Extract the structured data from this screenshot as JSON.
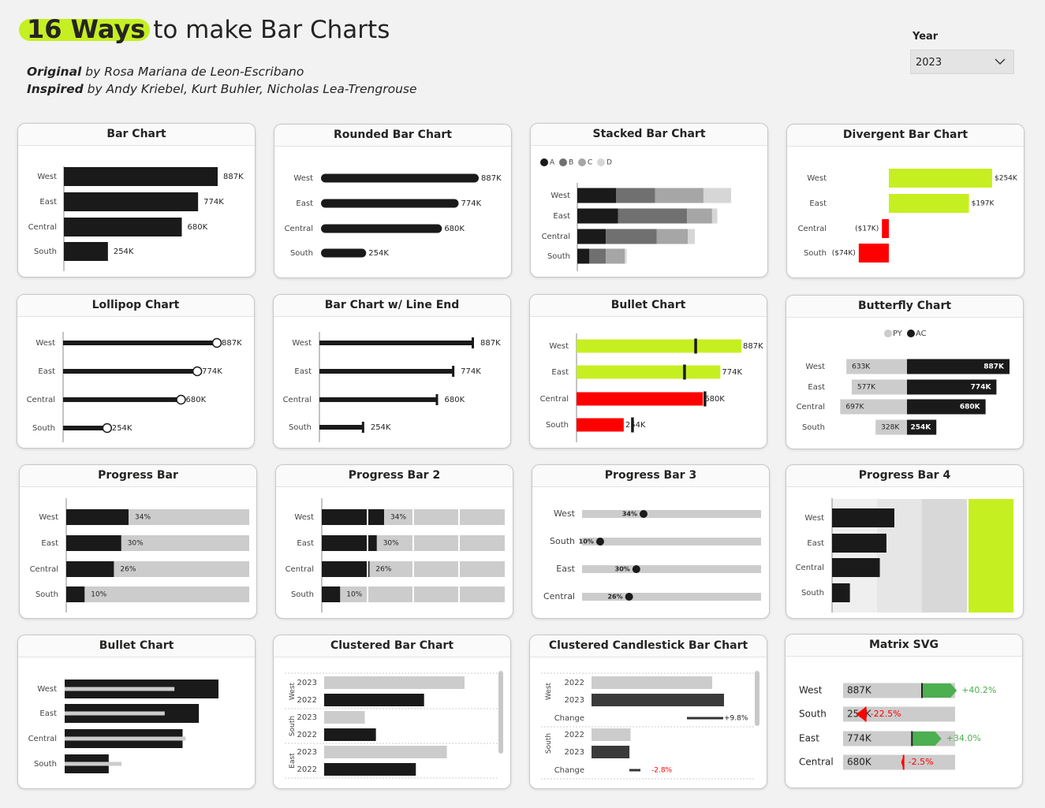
{
  "header": {
    "title_highlight": "16 Ways",
    "title_rest": " to make Bar Charts",
    "original_label": "Original",
    "original_by": " by Rosa Mariana de Leon-Escribano",
    "inspired_label": "Inspired",
    "inspired_by": " by Andy Kriebel, Kurt Buhler, Nicholas Lea-Trengrouse"
  },
  "filter": {
    "label": "Year",
    "value": "2023"
  },
  "colors": {
    "black": "#1a1a1a",
    "lime": "#c6ef21",
    "red": "#ff0000",
    "grey": "#cccccc",
    "darkgrey": "#707070",
    "midgrey": "#a6a6a6",
    "green": "#4caf50"
  },
  "cards": {
    "bar": {
      "title": "Bar Chart"
    },
    "rounded": {
      "title": "Rounded Bar Chart"
    },
    "stacked": {
      "title": "Stacked Bar Chart"
    },
    "divergent": {
      "title": "Divergent Bar Chart"
    },
    "lollipop": {
      "title": "Lollipop Chart"
    },
    "lineend": {
      "title": "Bar Chart w/ Line End"
    },
    "bullet1": {
      "title": "Bullet Chart"
    },
    "butterfly": {
      "title": "Butterfly Chart"
    },
    "progress1": {
      "title": "Progress Bar"
    },
    "progress2": {
      "title": "Progress Bar 2"
    },
    "progress3": {
      "title": "Progress Bar 3"
    },
    "progress4": {
      "title": "Progress Bar 4"
    },
    "bullet2": {
      "title": "Bullet Chart"
    },
    "clustered": {
      "title": "Clustered Bar Chart"
    },
    "candlestick": {
      "title": "Clustered Candlestick Bar Chart"
    },
    "matrix": {
      "title": "Matrix SVG"
    }
  },
  "chart_data": [
    {
      "id": "bar",
      "type": "bar",
      "title": "Bar Chart",
      "categories": [
        "West",
        "East",
        "Central",
        "South"
      ],
      "values": [
        887,
        774,
        680,
        254
      ],
      "labels": [
        "887K",
        "774K",
        "680K",
        "254K"
      ]
    },
    {
      "id": "rounded",
      "type": "bar",
      "title": "Rounded Bar Chart",
      "categories": [
        "West",
        "East",
        "Central",
        "South"
      ],
      "values": [
        887,
        774,
        680,
        254
      ],
      "labels": [
        "887K",
        "774K",
        "680K",
        "254K"
      ]
    },
    {
      "id": "stacked",
      "type": "bar",
      "title": "Stacked Bar Chart",
      "categories": [
        "West",
        "East",
        "Central",
        "South"
      ],
      "legend": [
        "A",
        "B",
        "C",
        "D"
      ],
      "series": [
        {
          "name": "A",
          "values": [
            225,
            235,
            165,
            70
          ]
        },
        {
          "name": "B",
          "values": [
            225,
            400,
            295,
            95
          ]
        },
        {
          "name": "C",
          "values": [
            280,
            145,
            180,
            110
          ]
        },
        {
          "name": "D",
          "values": [
            160,
            30,
            40,
            10
          ]
        }
      ]
    },
    {
      "id": "divergent",
      "type": "bar",
      "title": "Divergent Bar Chart",
      "categories": [
        "West",
        "East",
        "Central",
        "South"
      ],
      "values": [
        254,
        197,
        -17,
        -74
      ],
      "labels": [
        "$254K",
        "$197K",
        "($17K)",
        "($74K)"
      ]
    },
    {
      "id": "lollipop",
      "type": "bar",
      "title": "Lollipop Chart",
      "categories": [
        "West",
        "East",
        "Central",
        "South"
      ],
      "values": [
        887,
        774,
        680,
        254
      ],
      "labels": [
        "887K",
        "774K",
        "680K",
        "254K"
      ]
    },
    {
      "id": "lineend",
      "type": "bar",
      "title": "Bar Chart w/ Line End",
      "categories": [
        "West",
        "East",
        "Central",
        "South"
      ],
      "values": [
        887,
        774,
        680,
        254
      ],
      "labels": [
        "887K",
        "774K",
        "680K",
        "254K"
      ]
    },
    {
      "id": "bullet1",
      "type": "bar",
      "title": "Bullet Chart",
      "categories": [
        "West",
        "East",
        "Central",
        "South"
      ],
      "values": [
        887,
        774,
        680,
        254
      ],
      "targets": [
        640,
        580,
        690,
        300
      ],
      "status": [
        "lime",
        "lime",
        "red",
        "red"
      ],
      "labels": [
        "887K",
        "774K",
        "680K",
        "254K"
      ]
    },
    {
      "id": "butterfly",
      "type": "bar",
      "title": "Butterfly Chart",
      "categories": [
        "West",
        "East",
        "Central",
        "South"
      ],
      "legend": [
        "PY",
        "AC"
      ],
      "series": [
        {
          "name": "PY",
          "values": [
            633,
            577,
            697,
            328
          ],
          "labels": [
            "633K",
            "577K",
            "697K",
            "328K"
          ]
        },
        {
          "name": "AC",
          "values": [
            887,
            774,
            680,
            254
          ],
          "labels": [
            "887K",
            "774K",
            "680K",
            "254K"
          ]
        }
      ]
    },
    {
      "id": "progress1",
      "type": "bar",
      "title": "Progress Bar",
      "categories": [
        "West",
        "East",
        "Central",
        "South"
      ],
      "values": [
        34,
        30,
        26,
        10
      ],
      "labels": [
        "34%",
        "30%",
        "26%",
        "10%"
      ]
    },
    {
      "id": "progress2",
      "type": "bar",
      "title": "Progress Bar 2",
      "categories": [
        "West",
        "East",
        "Central",
        "South"
      ],
      "values": [
        34,
        30,
        26,
        10
      ],
      "labels": [
        "34%",
        "30%",
        "26%",
        "10%"
      ]
    },
    {
      "id": "progress3",
      "type": "bar",
      "title": "Progress Bar 3",
      "categories": [
        "West",
        "South",
        "East",
        "Central"
      ],
      "values": [
        34,
        10,
        30,
        26
      ],
      "labels": [
        "34%",
        "10%",
        "30%",
        "26%"
      ]
    },
    {
      "id": "progress4",
      "type": "bar",
      "title": "Progress Bar 4",
      "categories": [
        "West",
        "East",
        "Central",
        "South"
      ],
      "values": [
        887,
        774,
        680,
        254
      ]
    },
    {
      "id": "bullet2",
      "type": "bar",
      "title": "Bullet Chart",
      "categories": [
        "West",
        "East",
        "Central",
        "South"
      ],
      "values": [
        887,
        774,
        680,
        254
      ],
      "comparison": [
        633,
        577,
        697,
        328
      ]
    },
    {
      "id": "clustered",
      "type": "bar",
      "title": "Clustered Bar Chart",
      "groups": [
        "West",
        "South",
        "East"
      ],
      "years": [
        "2023",
        "2022"
      ],
      "rows": [
        {
          "group": "West",
          "year": "2023",
          "value": 819
        },
        {
          "group": "West",
          "year": "2022",
          "value": 583
        },
        {
          "group": "South",
          "year": "2023",
          "value": 237
        },
        {
          "group": "South",
          "year": "2022",
          "value": 302
        },
        {
          "group": "East",
          "year": "2023",
          "value": 716
        },
        {
          "group": "East",
          "year": "2022",
          "value": 535
        }
      ]
    },
    {
      "id": "candlestick",
      "type": "bar",
      "title": "Clustered Candlestick Bar Chart",
      "groups": [
        "West",
        "South"
      ],
      "change_label": "Change",
      "rows": [
        {
          "group": "West",
          "year": "2022",
          "value": 808
        },
        {
          "group": "West",
          "year": "2023",
          "value": 887
        },
        {
          "group": "South",
          "year": "2022",
          "value": 261
        },
        {
          "group": "South",
          "year": "2023",
          "value": 254
        }
      ],
      "changes": [
        {
          "group": "West",
          "value": 9.8,
          "label": "+9.8%"
        },
        {
          "group": "South",
          "value": -2.8,
          "label": "-2.8%"
        }
      ]
    },
    {
      "id": "matrix",
      "type": "table",
      "title": "Matrix SVG",
      "rows": [
        {
          "region": "West",
          "value": 887,
          "label": "887K",
          "change": 40.2,
          "change_label": "+40.2%"
        },
        {
          "region": "South",
          "value": 254,
          "label": "254K",
          "change": -22.5,
          "change_label": "-22.5%"
        },
        {
          "region": "East",
          "value": 774,
          "label": "774K",
          "change": 34.0,
          "change_label": "+34.0%"
        },
        {
          "region": "Central",
          "value": 680,
          "label": "680K",
          "change": -2.5,
          "change_label": "-2.5%"
        }
      ]
    }
  ]
}
